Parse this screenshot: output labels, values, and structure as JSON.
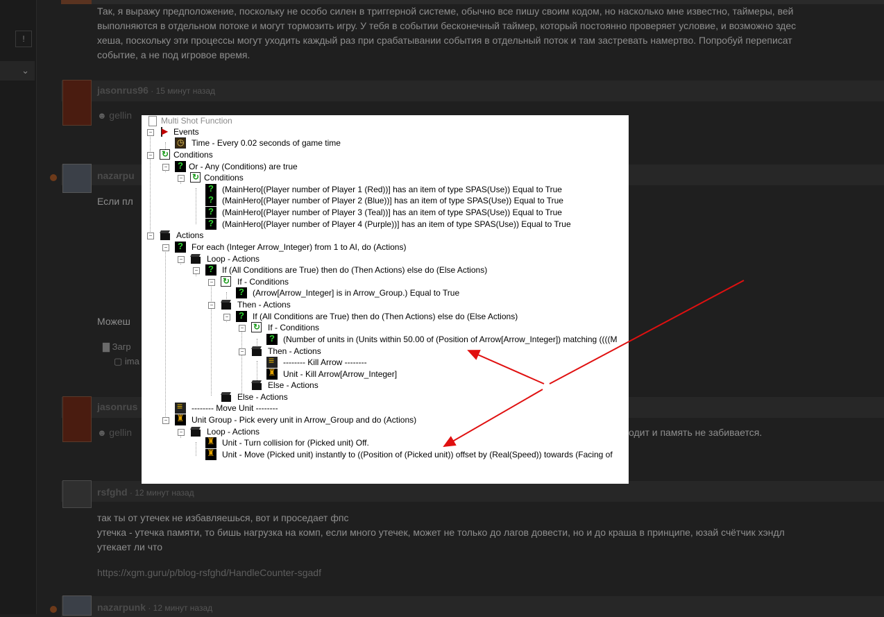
{
  "forum": {
    "top_text": [
      "Так, я выражу предположение, поскольку не особо силен в триггерной системе, обычно все пишу своим кодом, но насколько мне известно, таймеры, вей",
      "выполняются в отдельном потоке и могут тормозить игру. У тебя в событии бесконечный таймер, который постоянно проверяет условие, и возможно здес",
      "хеша, поскольку эти процессы могут уходить каждый раз при срабатывании события в отдельный поток и там застревать намертво. Попробуй переписат",
      "событие, а не под игровое время."
    ],
    "posts": [
      {
        "author": "jasonrus96",
        "time": " · 15 минут назад",
        "text": "gellin"
      },
      {
        "author": "nazarpu",
        "time": "",
        "text": "Если пл"
      },
      {
        "author": "jasonrus",
        "time": "",
        "text": "gellin",
        "tail": "одит и память не забивается."
      }
    ],
    "mid_text": "Можеш",
    "attach_folder": "Загр",
    "attach_file": "ima",
    "rsfghd": {
      "author": "rsfghd",
      "time": " · 12 минут назад",
      "lines": [
        "так ты от утечек не избавляешься, вот и проседает фпс",
        "утечка - утечка памяти, то бишь нагрузка на комп, если много утечек, может не только до лагов довести, но и до краша в принципе, юзай счётчик хэндл",
        "утекает ли что",
        "",
        "https://xgm.guru/p/blog-rsfghd/HandleCounter-sgadf"
      ]
    },
    "last_post": {
      "author": "nazarpunk",
      "time": " · 12 минут назад"
    },
    "rail_button": "!",
    "rail_chevron": "⌄"
  },
  "trigger": {
    "title": "Multi Shot Function",
    "rows": [
      "Events",
      "Time - Every 0.02 seconds of game time",
      "Conditions",
      "Or - Any (Conditions) are true",
      "Conditions",
      "(MainHero[(Player number of Player 1 (Red))] has an item of type SPAS(Use)) Equal to True",
      "(MainHero[(Player number of Player 2 (Blue))] has an item of type SPAS(Use)) Equal to True",
      "(MainHero[(Player number of Player 3 (Teal))] has an item of type SPAS(Use)) Equal to True",
      "(MainHero[(Player number of Player 4 (Purple))] has an item of type SPAS(Use)) Equal to True",
      "Actions",
      "For each (Integer Arrow_Integer) from 1 to AI, do (Actions)",
      "Loop - Actions",
      "If (All Conditions are True) then do (Then Actions) else do (Else Actions)",
      "If - Conditions",
      "(Arrow[Arrow_Integer] is in Arrow_Group.) Equal to True",
      "Then - Actions",
      "If (All Conditions are True) then do (Then Actions) else do (Else Actions)",
      "If - Conditions",
      "(Number of units in (Units within 50.00 of (Position of Arrow[Arrow_Integer]) matching ((((M",
      "Then - Actions",
      "-------- Kill Arrow --------",
      "Unit - Kill Arrow[Arrow_Integer]",
      "Else - Actions",
      "Else - Actions",
      "-------- Move Unit --------",
      "Unit Group - Pick every unit in Arrow_Group and do (Actions)",
      "Loop - Actions",
      "Unit - Turn collision for (Picked unit) Off.",
      "Unit - Move (Picked unit) instantly to ((Position of (Picked unit)) offset by (Real(Speed)) towards (Facing of"
    ]
  },
  "colors": {
    "arrow": "#e01010",
    "background": "#1f1f1f"
  }
}
